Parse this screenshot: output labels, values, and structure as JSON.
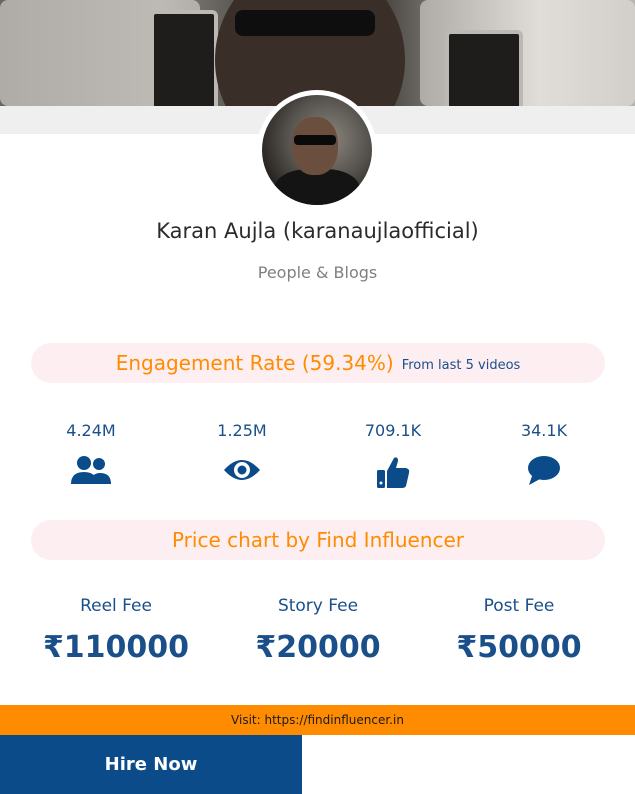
{
  "profile": {
    "name": "Karan Aujla (karanaujlaofficial)",
    "category": "People & Blogs"
  },
  "engagement": {
    "label": "Engagement Rate (59.34%)",
    "note": "From last 5 videos"
  },
  "stats": [
    {
      "value": "4.24M",
      "icon": "followers-icon"
    },
    {
      "value": "1.25M",
      "icon": "eye-icon"
    },
    {
      "value": "709.1K",
      "icon": "thumbs-up-icon"
    },
    {
      "value": "34.1K",
      "icon": "comment-icon"
    }
  ],
  "price_chart": {
    "title": "Price chart by Find Influencer",
    "fees": [
      {
        "label": "Reel Fee",
        "amount": "₹110000"
      },
      {
        "label": "Story Fee",
        "amount": "₹20000"
      },
      {
        "label": "Post Fee",
        "amount": "₹50000"
      }
    ]
  },
  "footer": {
    "visit": "Visit: https://findinfluencer.in",
    "hire_label": "Hire Now"
  },
  "colors": {
    "accent": "#ff8c00",
    "primary": "#1b4f8a",
    "pill_bg": "#fdeef2"
  }
}
